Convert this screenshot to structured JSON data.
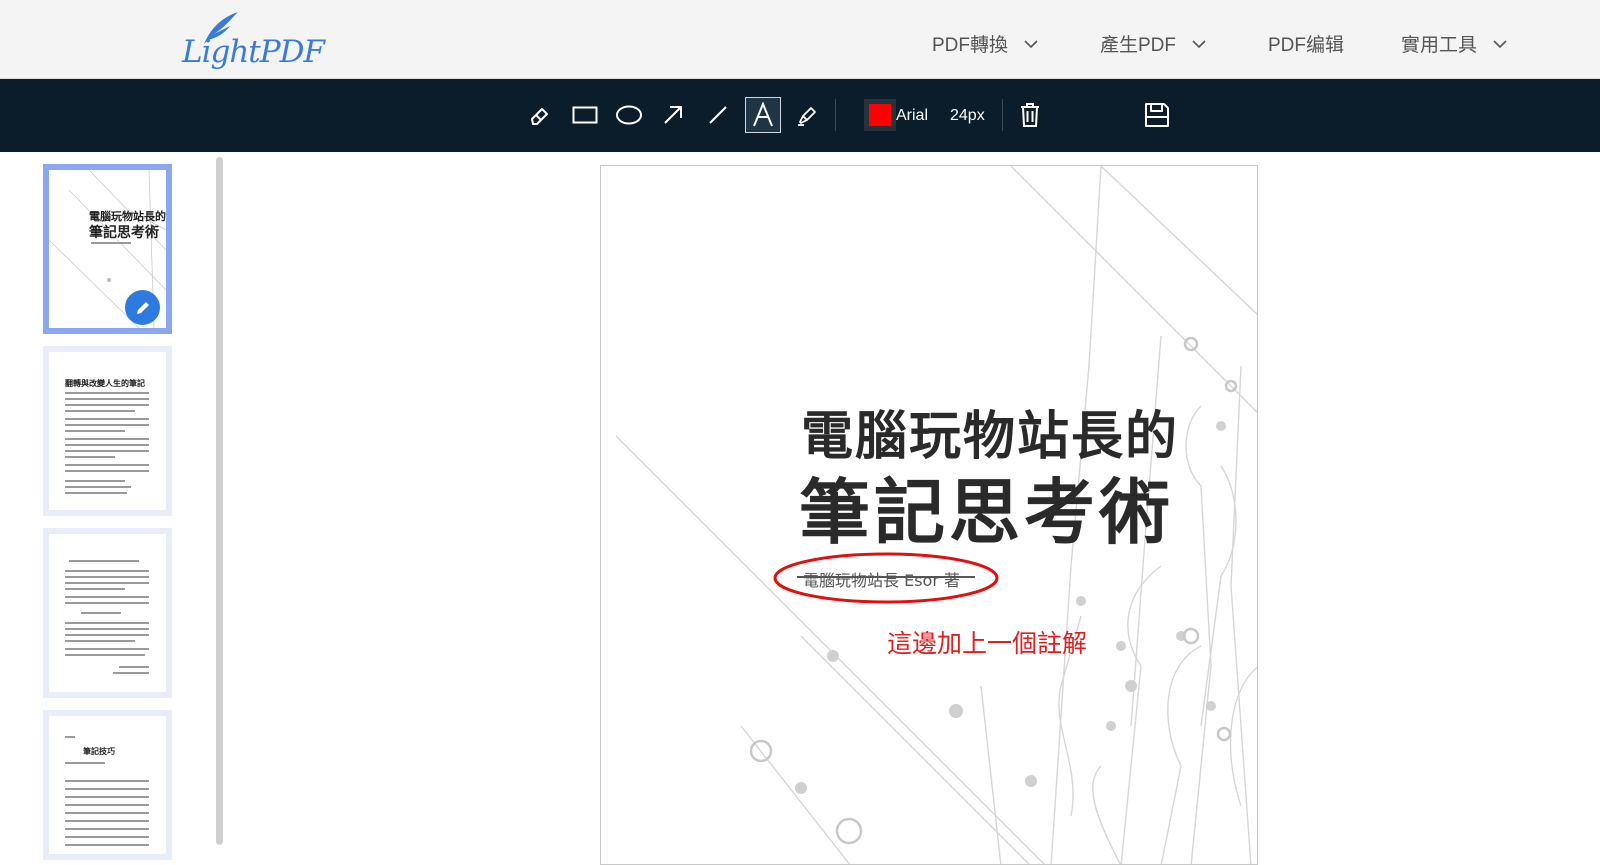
{
  "header": {
    "logo_text": "LightPDF",
    "menu": [
      {
        "label": "PDF轉換",
        "has_dropdown": true
      },
      {
        "label": "產生PDF",
        "has_dropdown": true
      },
      {
        "label": "PDF编辑",
        "has_dropdown": false
      },
      {
        "label": "實用工具",
        "has_dropdown": true
      }
    ]
  },
  "toolbar": {
    "tools": [
      "eraser-icon",
      "rectangle-icon",
      "ellipse-icon",
      "arrow-icon",
      "line-icon",
      "text-icon",
      "highlighter-icon"
    ],
    "active_tool": "text-icon",
    "color": "#ff0000",
    "font_name": "Arial",
    "font_size": "24px",
    "delete_icon": "trash-icon",
    "save_icon": "save-icon"
  },
  "sidebar": {
    "thumbnails": [
      {
        "page": 1,
        "selected": true,
        "title_line1": "電腦玩物站長的",
        "title_line2": "筆記思考術"
      },
      {
        "page": 2,
        "selected": false,
        "heading": "翻轉與改變人生的筆記"
      },
      {
        "page": 3,
        "selected": false
      },
      {
        "page": 4,
        "selected": false,
        "heading": "筆記技巧"
      }
    ]
  },
  "document": {
    "title_line1": "電腦玩物站長的",
    "title_line2": "筆記思考術",
    "author": "電腦玩物站長 Esor 著",
    "annotation_text": "這邊加上一個註解",
    "annotation_color": "#e02020",
    "ellipse_color": "#e01010"
  }
}
